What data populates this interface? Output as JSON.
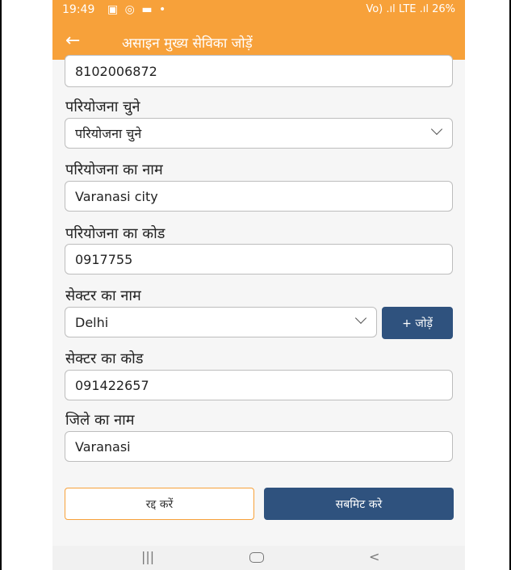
{
  "status_bar": {
    "time": "19:49",
    "left_icons": "▣ ◎ ▬ •",
    "right_text": "Vo) .ıl LTE .ıl 26%"
  },
  "app_bar": {
    "back_icon": "←",
    "title": "असाइन मुख्य सेविका जोड़ें"
  },
  "form": {
    "mobile_value": "8102006872",
    "project_select_label": "परियोजना चुने",
    "project_select_value": "परियोजना चुने",
    "project_name_label": "परियोजना का नाम",
    "project_name_value": "Varanasi city",
    "project_code_label": "परियोजना का कोड",
    "project_code_value": "0917755",
    "sector_name_label": "सेक्टर का नाम",
    "sector_name_value": "Delhi",
    "add_button_label": "+ जोड़ें",
    "sector_code_label": "सेक्टर का कोड",
    "sector_code_value": "091422657",
    "district_name_label": "जिले का नाम",
    "district_name_value": "Varanasi"
  },
  "actions": {
    "cancel_label": "रद्द करें",
    "submit_label": "सबमिट करे"
  },
  "nav_bar": {
    "recents_icon": "|||",
    "back_icon": "<"
  },
  "colors": {
    "accent": "#f7a13a",
    "primary_button": "#2f527e"
  }
}
